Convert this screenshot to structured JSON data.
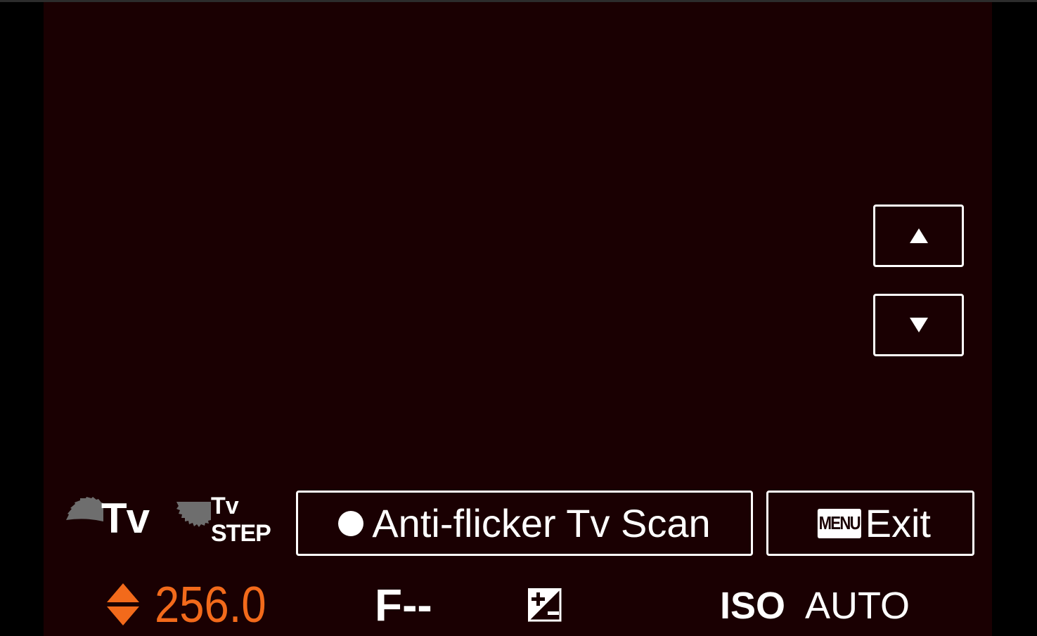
{
  "mode_icons": {
    "main_dial_label": "Tv",
    "step_dial_label_top": "Tv",
    "step_dial_label_bottom": "STEP"
  },
  "controls": {
    "scan_button_label": "Anti-flicker Tv Scan",
    "menu_badge": "MENU",
    "exit_button_label": "Exit",
    "up_icon": "triangle-up-icon",
    "down_icon": "triangle-down-icon"
  },
  "status": {
    "shutter_speed": "256.0",
    "aperture": "F--",
    "exposure_compensation_icon": "exposure-compensation-icon",
    "iso_label": "ISO",
    "iso_value": "AUTO"
  },
  "colors": {
    "background": "#1a0002",
    "accent": "#f26a1b",
    "foreground": "#ffffff"
  }
}
